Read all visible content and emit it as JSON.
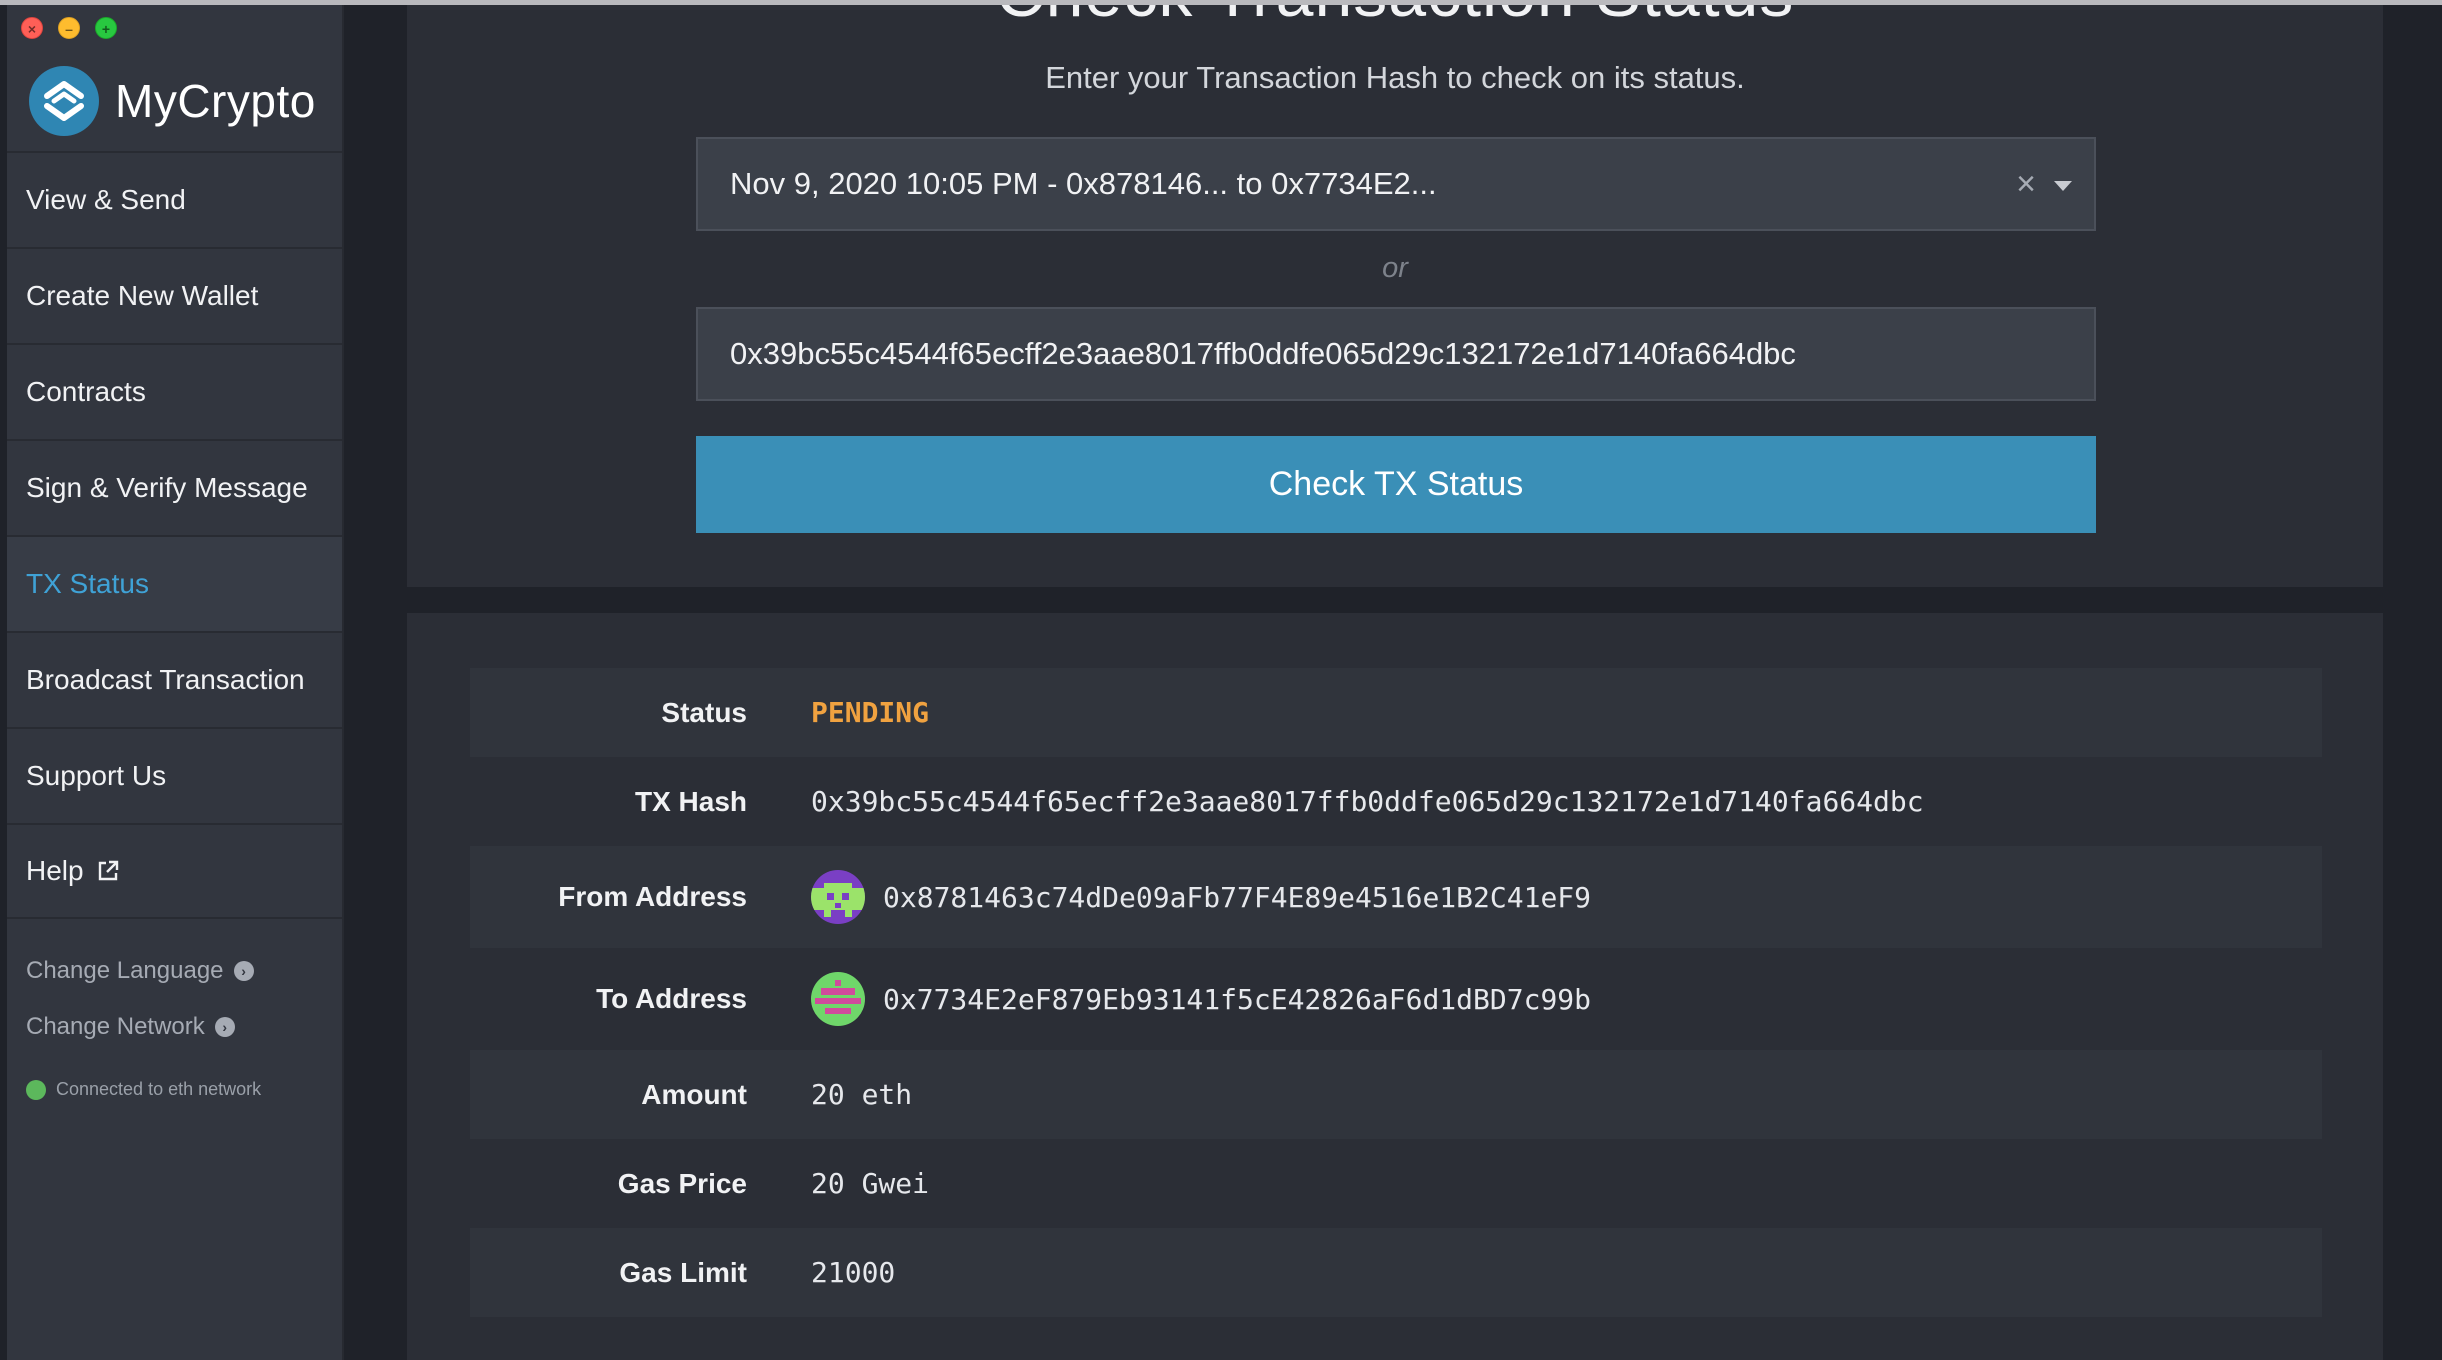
{
  "window": {
    "controls": [
      "close",
      "minimize",
      "maximize"
    ]
  },
  "sidebar": {
    "brand": "MyCrypto",
    "items": [
      {
        "label": "View & Send",
        "active": false
      },
      {
        "label": "Create New Wallet",
        "active": false
      },
      {
        "label": "Contracts",
        "active": false
      },
      {
        "label": "Sign & Verify Message",
        "active": false
      },
      {
        "label": "TX Status",
        "active": true
      },
      {
        "label": "Broadcast Transaction",
        "active": false
      },
      {
        "label": "Support Us",
        "active": false
      },
      {
        "label": "Help",
        "active": false,
        "icon": "external-link-icon"
      }
    ],
    "change_language": "Change Language",
    "change_network": "Change Network",
    "network_status": "Connected to eth network",
    "network_status_color": "#5cb85c"
  },
  "main": {
    "title": "Check Transaction Status",
    "subtitle": "Enter your Transaction Hash to check on its status.",
    "recent_tx_select": "Nov 9, 2020 10:05 PM - 0x878146... to 0x7734E2...",
    "or": "or",
    "tx_hash_input": "0x39bc55c4544f65ecff2e3aae8017ffb0ddfe065d29c132172e1d7140fa664dbc",
    "check_button": "Check TX Status",
    "accent_color": "#3a8fb7"
  },
  "details": {
    "status_label": "Status",
    "status_value": "PENDING",
    "status_color": "#f0a240",
    "tx_hash_label": "TX Hash",
    "tx_hash_value": "0x39bc55c4544f65ecff2e3aae8017ffb0ddfe065d29c132172e1d7140fa664dbc",
    "from_label": "From Address",
    "from_value": "0x8781463c74dDe09aFb77F4E89e4516e1B2C41eF9",
    "to_label": "To Address",
    "to_value": "0x7734E2eF879Eb93141f5cE42826aF6d1dBD7c99b",
    "amount_label": "Amount",
    "amount_value": "20 eth",
    "gas_price_label": "Gas Price",
    "gas_price_value": "20 Gwei",
    "gas_limit_label": "Gas Limit",
    "gas_limit_value": "21000"
  }
}
